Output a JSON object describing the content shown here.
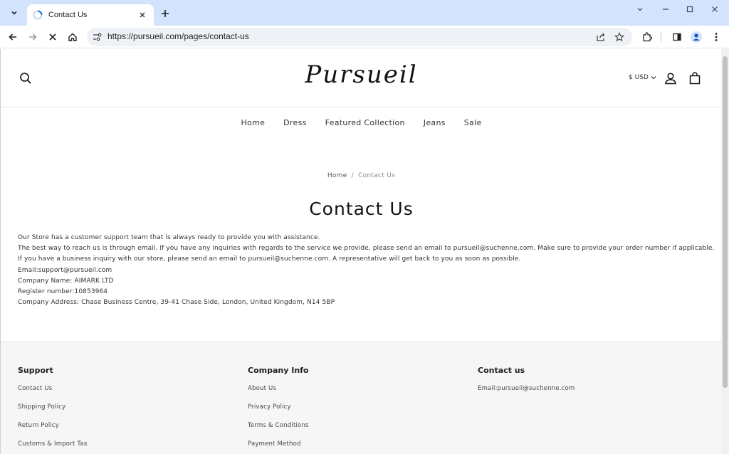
{
  "browser": {
    "tab_title": "Contact Us",
    "url": "https://pursueil.com/pages/contact-us"
  },
  "header": {
    "logo": "Pursueil",
    "currency": "$ USD"
  },
  "nav": {
    "items": [
      {
        "label": "Home"
      },
      {
        "label": "Dress"
      },
      {
        "label": "Featured Collection"
      },
      {
        "label": "Jeans"
      },
      {
        "label": "Sale"
      }
    ]
  },
  "breadcrumb": {
    "home": "Home",
    "separator": "/",
    "current": "Contact Us"
  },
  "page_title": "Contact Us",
  "content": {
    "lines": [
      "Our Store has a customer support team that is always ready to provide you with assistance.",
      "The best way to reach us is through email. If you have any inquiries with regards to the service we provide, please send an email to pursueil@suchenne.com. Make sure to provide your order number if applicable.",
      "If you have a business inquiry with our store, please send an email to pursueil@suchenne.com. A representative will get back to you as soon as possible.",
      "Email:support@pursueil.com",
      "Company Name: AIMARK LTD",
      "Register number:10853964",
      "Company Address: Chase Business Centre, 39-41 Chase Side, London, United Kingdom, N14 5BP"
    ]
  },
  "footer": {
    "support": {
      "heading": "Support",
      "links": [
        "Contact Us",
        "Shipping Policy",
        "Return Policy",
        "Customs & Import Tax"
      ]
    },
    "company": {
      "heading": "Company Info",
      "links": [
        "About Us",
        "Privacy Policy",
        "Terms & Conditions",
        "Payment Method"
      ]
    },
    "contact": {
      "heading": "Contact us",
      "email": "Email:pursueil@suchenne.com"
    }
  },
  "colors": {
    "tabbar_bg": "#d3e3fd",
    "footer_bg": "#f6f6f6",
    "text": "#121212"
  }
}
